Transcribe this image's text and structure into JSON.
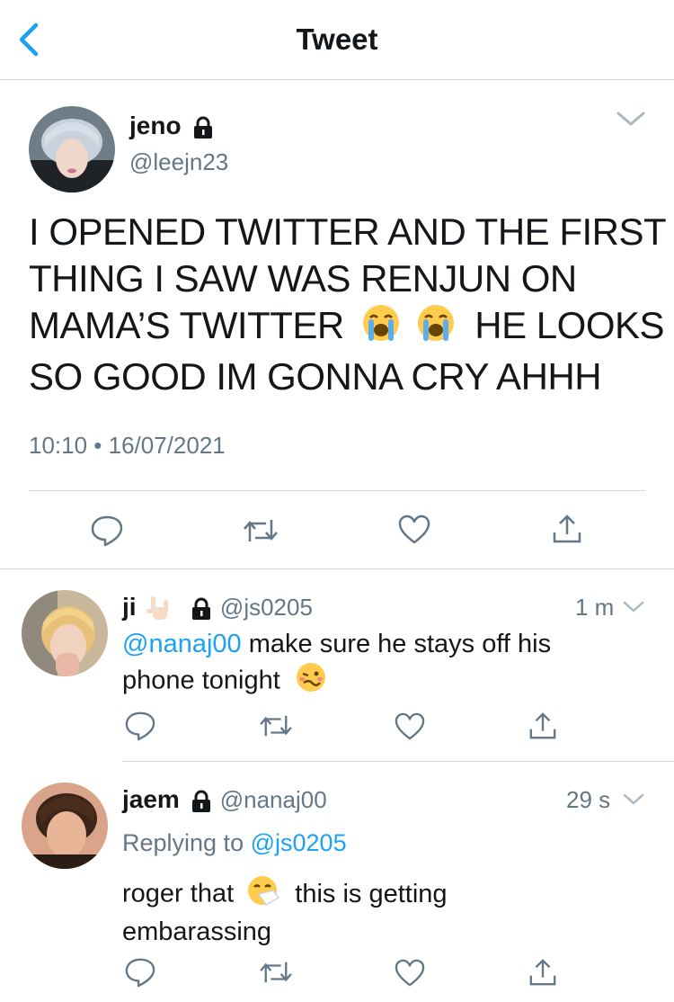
{
  "header": {
    "title": "Tweet"
  },
  "main": {
    "name": "jeno",
    "handle": "@leejn23",
    "line1": "I OPENED TWITTER AND THE FIRST",
    "line2": "THING I SAW WAS RENJUN ON",
    "line3a": "MAMA’S TWITTER",
    "line3b": "HE LOOKS",
    "line4": "SO GOOD IM GONNA CRY AHHH",
    "timestamp": "10:10 • 16/07/2021"
  },
  "replies": [
    {
      "name": "ji",
      "handle": "@js0205",
      "time": "1 m",
      "mention": "@nanaj00",
      "text_a": "make sure he stays off his",
      "text_b": "phone tonight"
    },
    {
      "name": "jaem",
      "handle": "@nanaj00",
      "time": "29 s",
      "replying_prefix": "Replying to",
      "replying_to": "@js0205",
      "text_a": "roger that",
      "text_a2": "this is getting",
      "text_b": "embarassing"
    }
  ],
  "icons": [
    "chevron-left-icon",
    "chevron-down-icon",
    "lock-icon",
    "reply-icon",
    "retweet-icon",
    "like-icon",
    "share-icon"
  ],
  "colors": {
    "accent": "#1da1f2",
    "secondary": "#657786",
    "text": "#14171a"
  }
}
